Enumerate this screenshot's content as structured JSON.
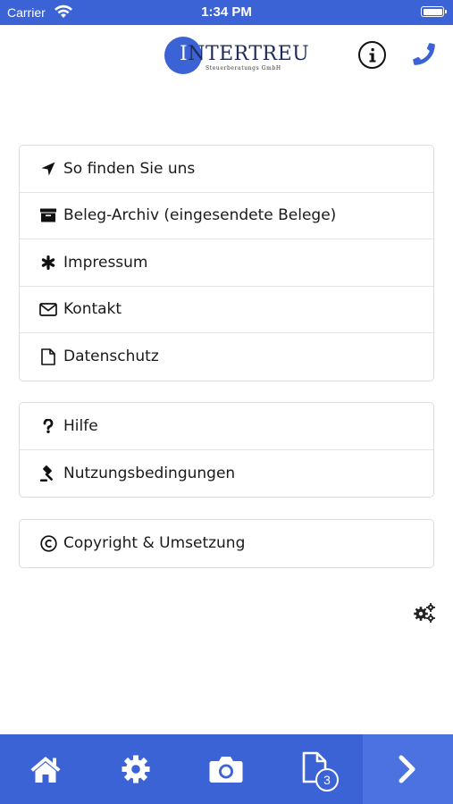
{
  "status_bar": {
    "carrier": "Carrier",
    "time": "1:34 PM"
  },
  "header": {
    "logo_first_letter": "I",
    "logo_rest": "NTERTREU",
    "logo_subtitle": "Steuerberatungs GmbH",
    "info_icon": "info-circle-icon",
    "phone_icon": "phone-icon"
  },
  "menu_primary": [
    {
      "icon": "location-arrow-icon",
      "label": "So finden Sie uns"
    },
    {
      "icon": "archive-box-icon",
      "label": "Beleg-Archiv (eingesendete Belege)"
    },
    {
      "icon": "asterisk-icon",
      "label": "Impressum"
    },
    {
      "icon": "envelope-icon",
      "label": "Kontakt"
    },
    {
      "icon": "document-icon",
      "label": "Datenschutz"
    }
  ],
  "menu_secondary": [
    {
      "icon": "question-icon",
      "label": "Hilfe"
    },
    {
      "icon": "gavel-icon",
      "label": "Nutzungsbedingungen"
    }
  ],
  "menu_tertiary": [
    {
      "icon": "copyright-icon",
      "label": "Copyright & Umsetzung"
    }
  ],
  "tab_bar": {
    "tabs": [
      "home-icon",
      "settings-gear-icon",
      "camera-icon",
      "documents-icon",
      "next-chevron-icon"
    ],
    "documents_badge": "3"
  },
  "colors": {
    "brand_blue": "#3b63d6",
    "next_tab_blue": "#4b72e0"
  }
}
